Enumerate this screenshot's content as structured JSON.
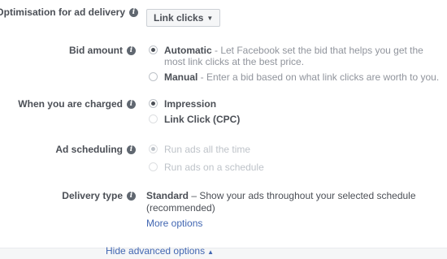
{
  "optimisation": {
    "label": "Optimisation for ad delivery",
    "value": "Link clicks"
  },
  "bid_amount": {
    "label": "Bid amount",
    "options": [
      {
        "title": "Automatic",
        "desc": " - Let Facebook set the bid that helps you get the most link clicks at the best price.",
        "selected": true
      },
      {
        "title": "Manual",
        "desc": " - Enter a bid based on what link clicks are worth to you.",
        "selected": false
      }
    ]
  },
  "charged": {
    "label": "When you are charged",
    "options": [
      {
        "title": "Impression",
        "selected": true
      },
      {
        "title": "Link Click (CPC)",
        "selected": false
      }
    ]
  },
  "scheduling": {
    "label": "Ad scheduling",
    "options": [
      {
        "title": "Run ads all the time",
        "selected": true
      },
      {
        "title": "Run ads on a schedule",
        "selected": false
      }
    ]
  },
  "delivery_type": {
    "label": "Delivery type",
    "title": "Standard",
    "desc": " – Show your ads throughout your selected schedule (recommended)",
    "more_options": "More options"
  },
  "hide_advanced": "Hide advanced options",
  "icons": {
    "info": "info-icon",
    "caret_down": "caret-down-icon",
    "caret_up": "caret-up-icon"
  }
}
